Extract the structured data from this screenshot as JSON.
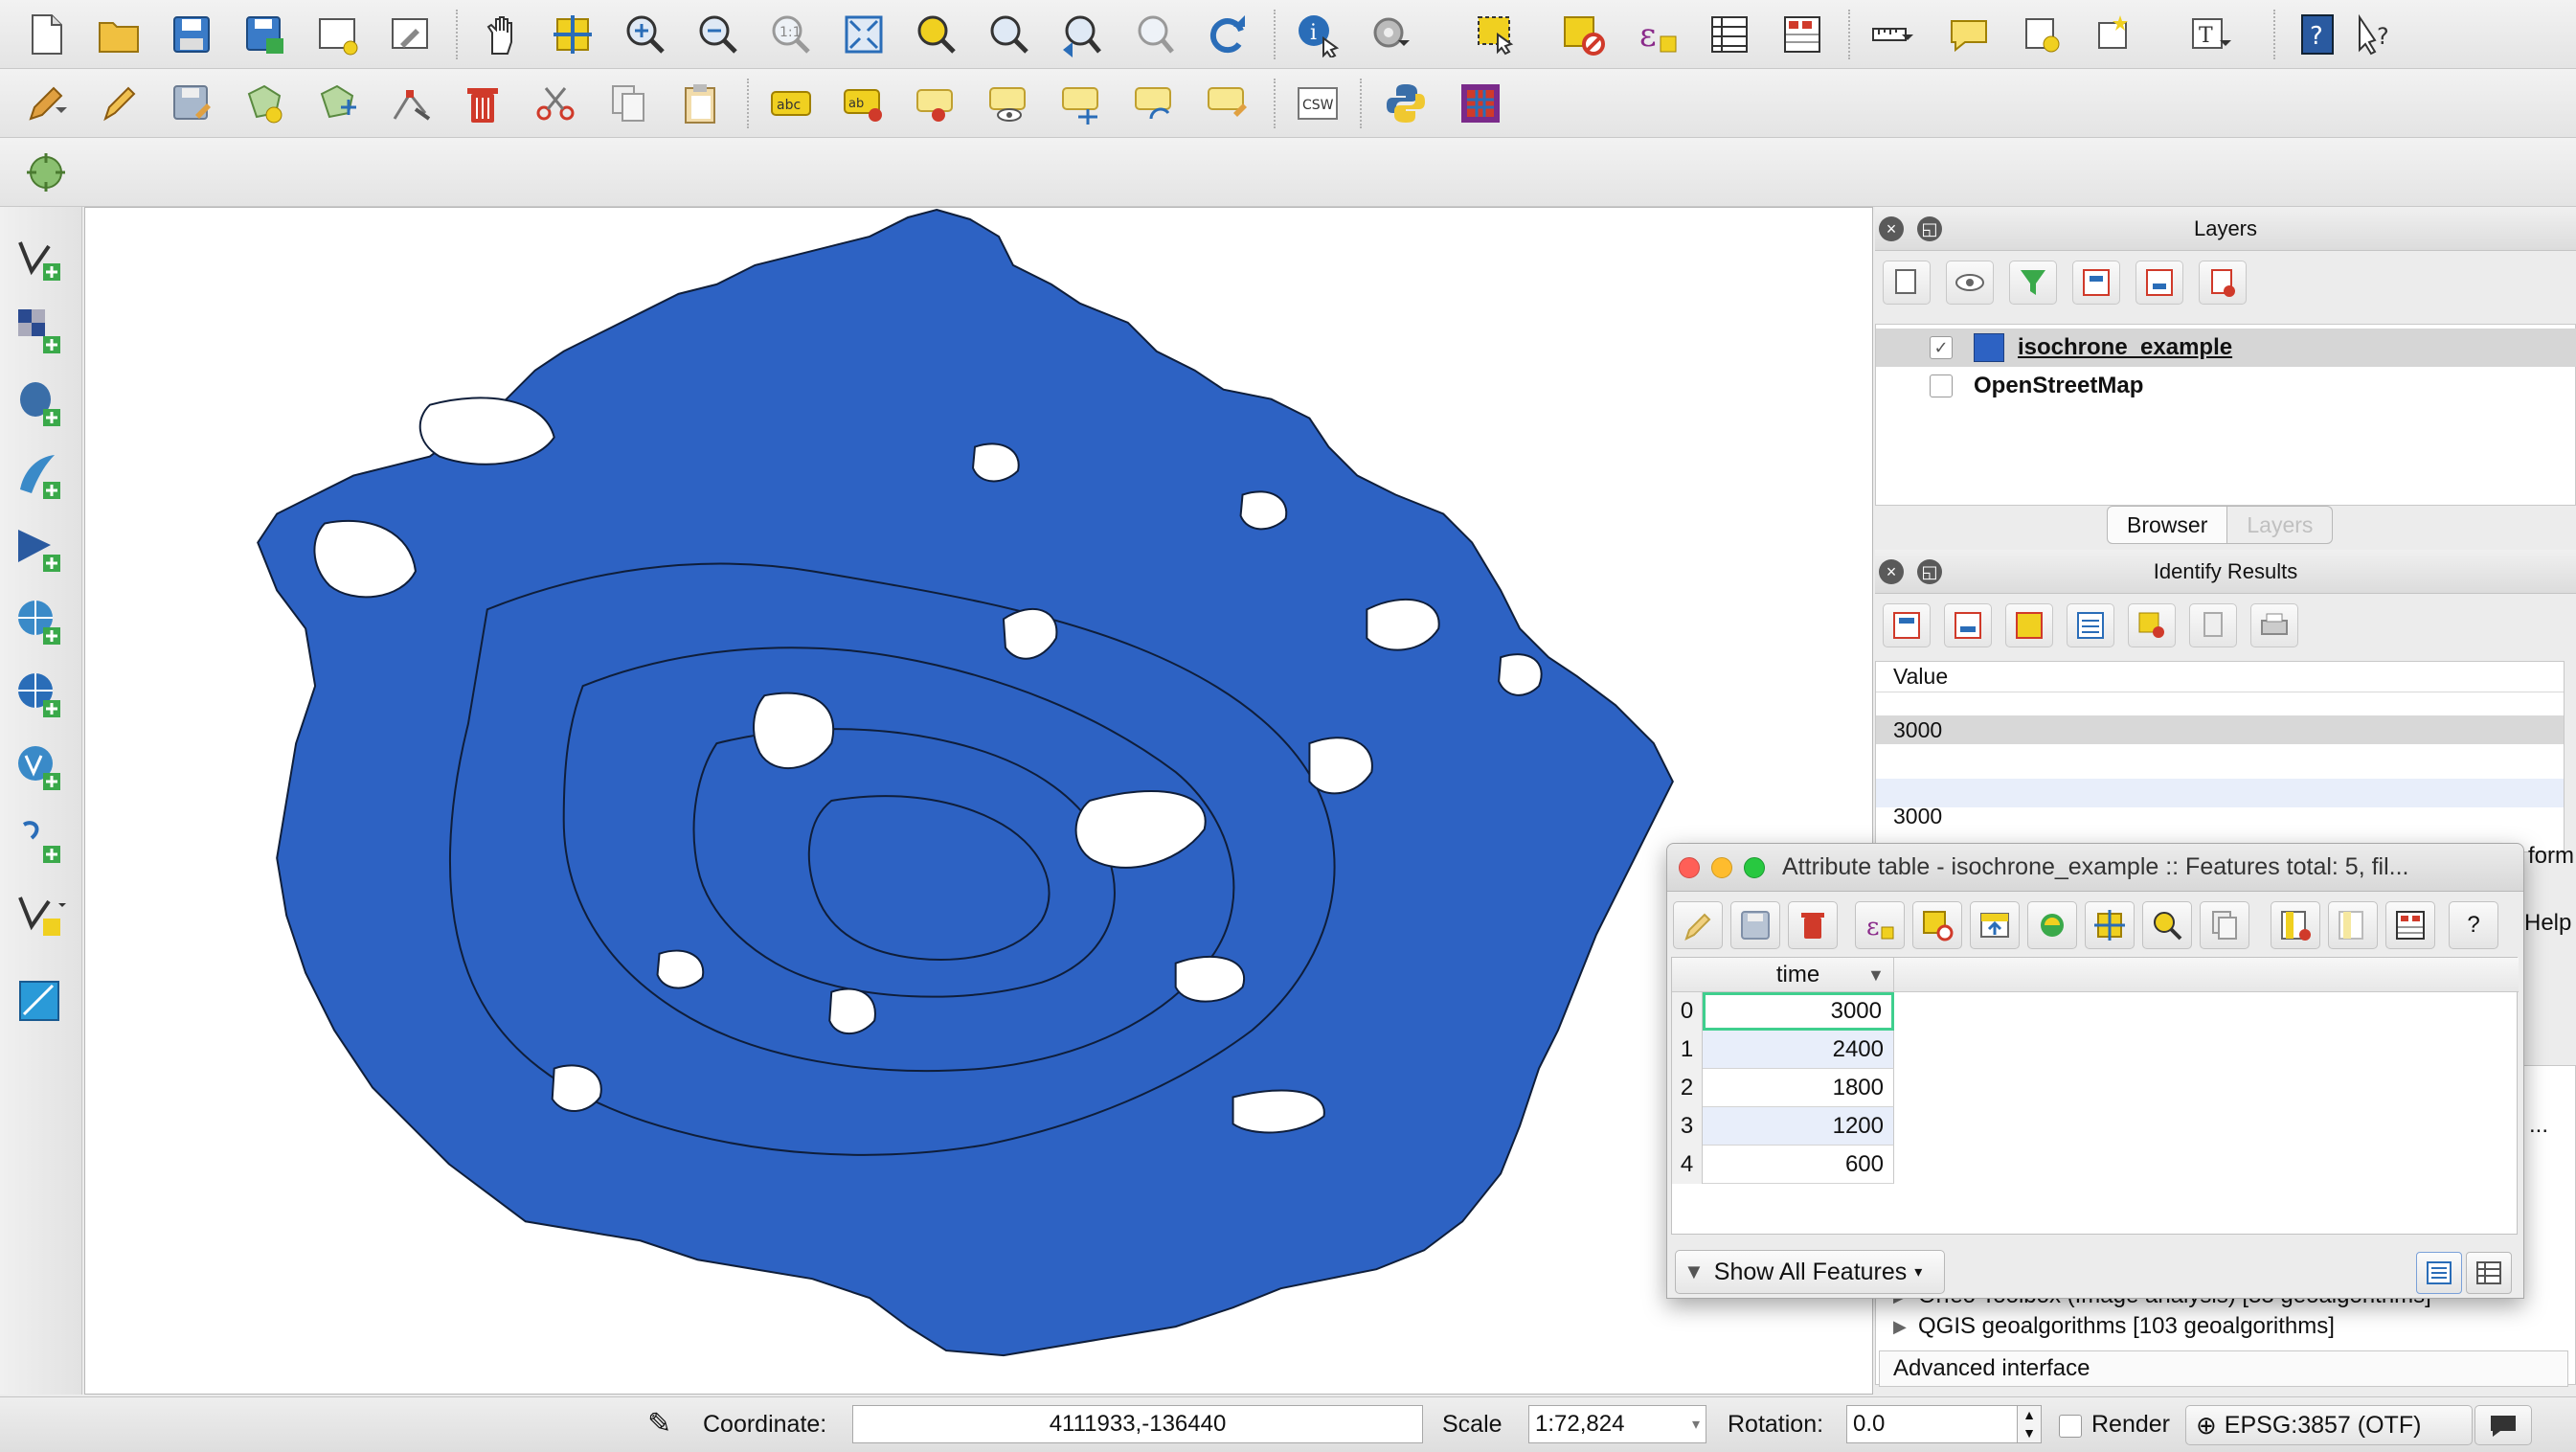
{
  "icon_colors": {
    "map_fill": "#2d62c3",
    "map_stroke": "#0f1e3a",
    "accent_yellow": "#f0d020",
    "accent_green": "#3aa94a",
    "accent_red": "#d03a2a",
    "icon_blue": "#2a6db8"
  },
  "toolbars": {
    "row1_icons": [
      "new-project-icon",
      "open-project-icon",
      "save-project-icon",
      "save-as-icon",
      "new-print-composer-icon",
      "composer-manager-icon",
      "pan-icon",
      "pan-to-selection-icon",
      "zoom-in-icon",
      "zoom-out-icon",
      "zoom-native-icon",
      "zoom-full-icon",
      "zoom-to-selection-icon",
      "zoom-to-layer-icon",
      "zoom-last-icon",
      "zoom-next-icon",
      "refresh-icon",
      "identify-icon",
      "action-icon",
      "select-features-icon",
      "deselect-icon",
      "select-by-expression-icon",
      "open-attribute-table-icon",
      "open-field-calculator-icon",
      "measure-icon",
      "map-tips-icon",
      "new-bookmark-icon",
      "show-bookmarks-icon",
      "text-annotation-icon",
      "help-icon",
      "whats-this-icon"
    ],
    "row2_icons": [
      "current-edits-icon",
      "toggle-editing-icon",
      "save-layer-edits-icon",
      "add-feature-icon",
      "move-feature-icon",
      "node-tool-icon",
      "delete-selected-icon",
      "cut-features-icon",
      "copy-features-icon",
      "paste-features-icon",
      "layer-labeling-icon",
      "label-pin-icon",
      "label-highlight-icon",
      "label-show-hide-icon",
      "label-move-icon",
      "label-rotate-icon",
      "label-change-icon",
      "csw-icon",
      "python-console-icon",
      "plugin-icon"
    ],
    "csw_label": "CSW",
    "abc_label": "abc"
  },
  "layers_panel": {
    "title": "Layers",
    "layers": [
      {
        "name": "isochrone_example",
        "checked": true,
        "selected": true
      },
      {
        "name": "OpenStreetMap",
        "checked": false,
        "selected": false
      }
    ],
    "tabs": {
      "active": "Browser",
      "inactive": "Layers"
    }
  },
  "identify_panel": {
    "title": "Identify Results",
    "column_header": "Value",
    "rows": [
      "3000",
      "",
      "3000"
    ],
    "peek_form": "form",
    "peek_help": "Help"
  },
  "attribute_table": {
    "title": "Attribute table - isochrone_example :: Features total: 5, fil...",
    "column": "time",
    "sort_glyph": "▼",
    "rows": [
      {
        "index": "0",
        "time": "3000"
      },
      {
        "index": "1",
        "time": "2400"
      },
      {
        "index": "2",
        "time": "1800"
      },
      {
        "index": "3",
        "time": "1200"
      },
      {
        "index": "4",
        "time": "600"
      }
    ],
    "show_all_label": "Show All Features",
    "help_glyph": "?"
  },
  "processing_toolbox": {
    "items": [
      "Orfeo Toolbox (Image analysis) [33 geoalgorithms]",
      "QGIS geoalgorithms [103 geoalgorithms]"
    ],
    "advanced_label": "Advanced interface",
    "peek_ellipsis": "..."
  },
  "status_bar": {
    "coordinate_label": "Coordinate:",
    "coordinate_value": "4111933,-136440",
    "scale_label": "Scale",
    "scale_value": "1:72,824",
    "rotation_label": "Rotation:",
    "rotation_value": "0.0",
    "render_label": "Render",
    "render_checked": false,
    "crs_label": "EPSG:3857 (OTF)"
  }
}
